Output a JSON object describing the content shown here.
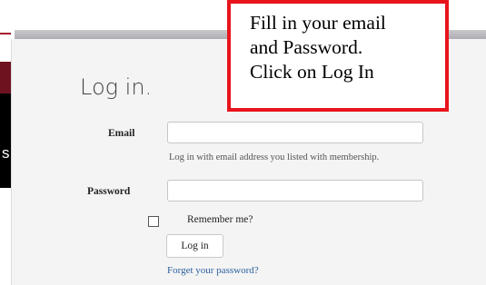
{
  "left_panel": {
    "fragment_text": "s"
  },
  "login": {
    "title": "Log in.",
    "email_label": "Email",
    "email_value": "",
    "email_help": "Log in with email address you listed with membership.",
    "password_label": "Password",
    "password_value": "",
    "remember_label": "Remember me?",
    "remember_checked": false,
    "login_button": "Log in",
    "forgot_link": "Forget your password?"
  },
  "callout": {
    "lines": [
      "Fill in your email",
      "and Password.",
      "Click on Log In"
    ]
  },
  "colors": {
    "callout_border": "#e8141c",
    "left_accent": "#6f1220",
    "link": "#2b5f9e"
  }
}
